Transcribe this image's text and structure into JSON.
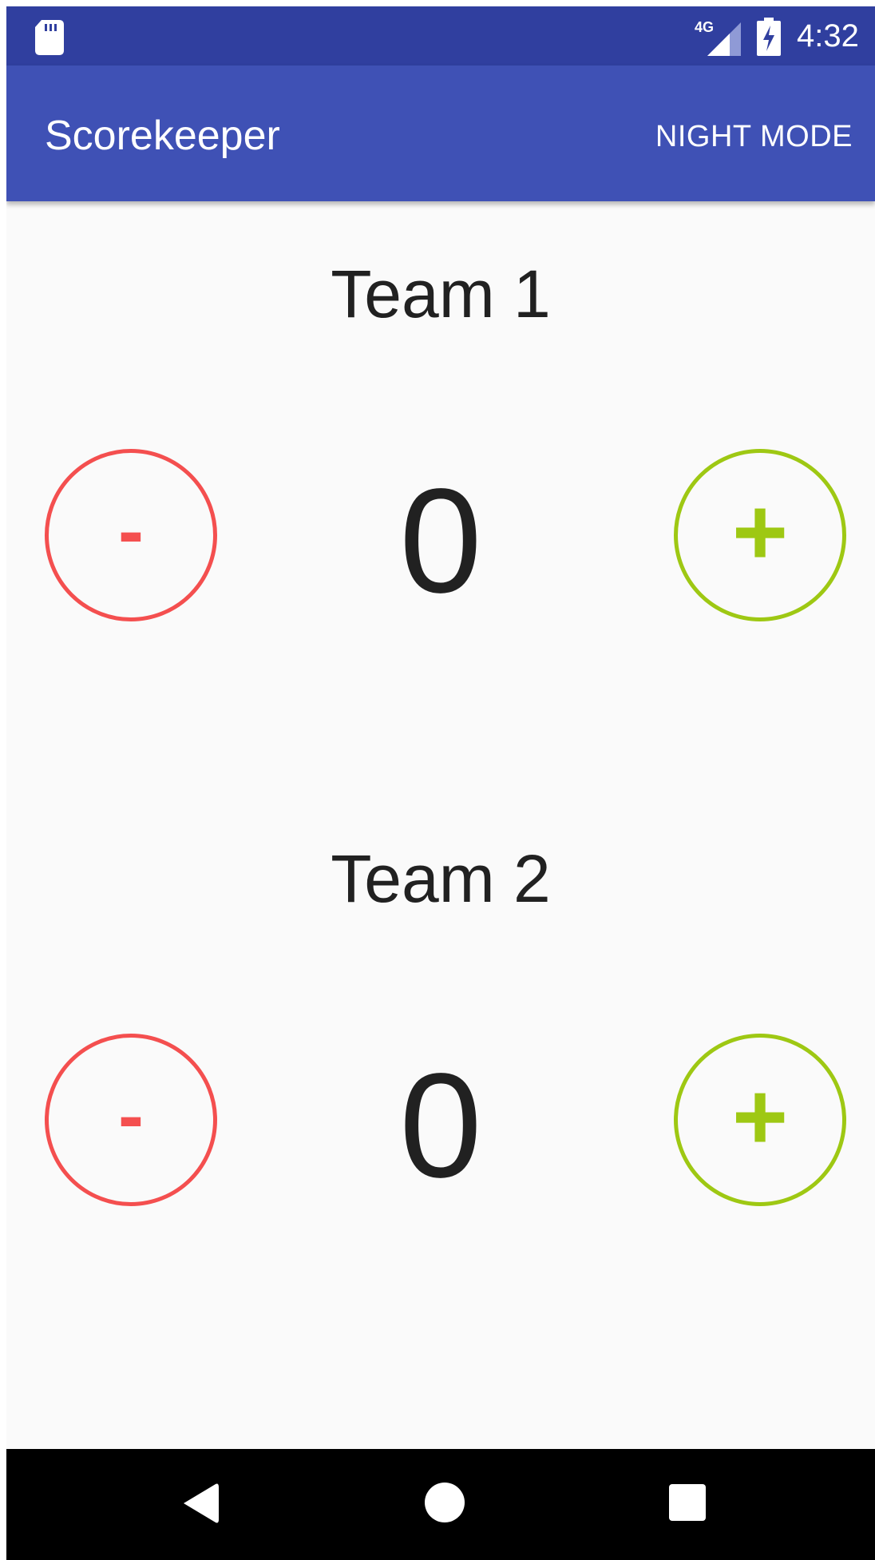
{
  "status_bar": {
    "network_label": "4G",
    "time": "4:32",
    "icons": [
      "sd-card-icon",
      "signal-icon",
      "battery-charging-icon"
    ]
  },
  "app_bar": {
    "title": "Scorekeeper",
    "action_label": "NIGHT MODE"
  },
  "teams": [
    {
      "name": "Team 1",
      "score": "0",
      "decrement_label": "-",
      "increment_label": "+"
    },
    {
      "name": "Team 2",
      "score": "0",
      "decrement_label": "-",
      "increment_label": "+"
    }
  ],
  "nav_bar": {
    "icons": [
      "back-icon",
      "home-icon",
      "recents-icon"
    ]
  },
  "colors": {
    "status_bar": "#303f9f",
    "app_bar": "#3f51b5",
    "decrement": "#f44f4f",
    "increment": "#9ec813",
    "text": "#212121",
    "background": "#fafafa"
  }
}
